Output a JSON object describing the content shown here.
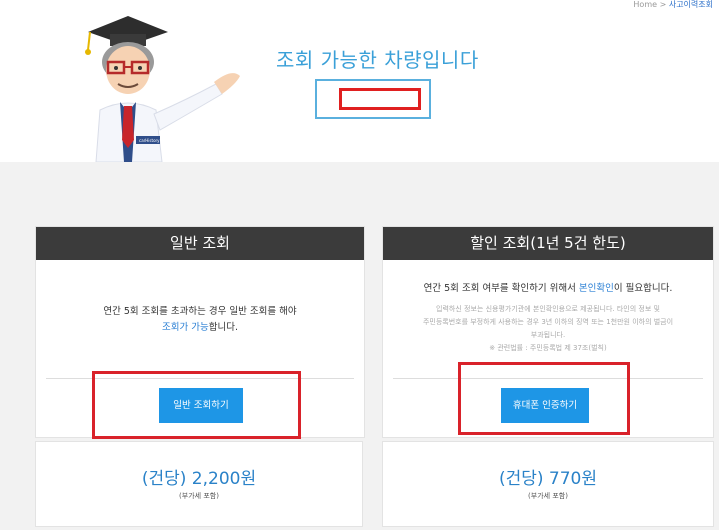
{
  "breadcrumb": {
    "home": "Home",
    "separator": ">",
    "current": "사고이력조회"
  },
  "hero": {
    "title": "조회 가능한 차량입니다",
    "plate_value": ""
  },
  "mascot": {
    "badge_text": "carHistory"
  },
  "general": {
    "title": "일반 조회",
    "desc_line1": "연간 5회 조회를 초과하는 경우 일반 조회를 해야",
    "desc_accent": "조회가 가능",
    "desc_tail": "합니다.",
    "button": "일반 조회하기",
    "price": "(건당) 2,200원",
    "vat": "(부가세 포함)"
  },
  "discount": {
    "title": "할인 조회(1년 5건 한도)",
    "desc_prefix": "연간 5회 조회 여부를 확인하기 위해서 ",
    "desc_accent": "본인확인",
    "desc_tail": "이 필요합니다.",
    "note_line1": "입력하신 정보는 신용평가기관에 본인확인용으로 제공됩니다. 타인의 정보 및",
    "note_line2": "주민등록번호를 부정하게 사용하는 경우 3년 이하의 징역 또는 1천만원 이하의 벌금이",
    "note_line3": "부과됩니다.",
    "law": "※ 관련법률 : 주민등록법 제 37조(벌칙)",
    "button": "휴대폰 인증하기",
    "price": "(건당) 770원",
    "vat": "(부가세 포함)"
  },
  "colors": {
    "accent": "#1e96e6",
    "header": "#3b3b3b",
    "highlight": "#d9222a",
    "title": "#3aa0d8"
  }
}
